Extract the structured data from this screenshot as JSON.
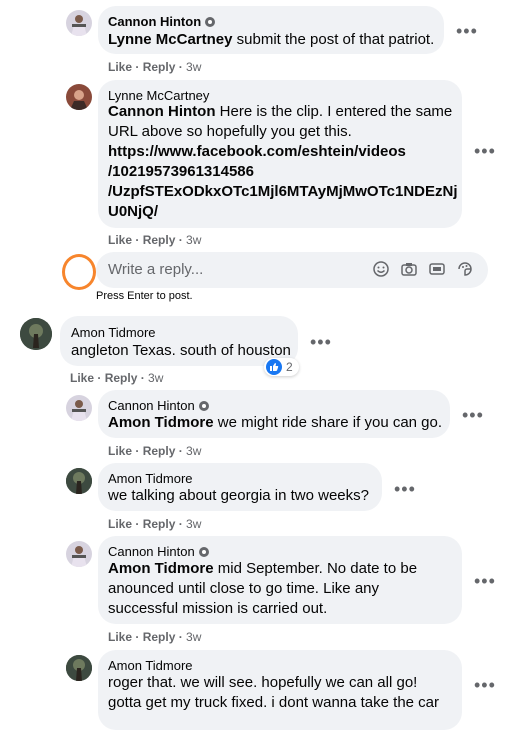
{
  "comments": [
    {
      "name": "Cannon Hinton",
      "mention": "Lynne McCartney",
      "text": " submit the post of that patriot.",
      "like": "Like",
      "reply": "Reply",
      "time": "3w"
    },
    {
      "name": "Lynne McCartney",
      "mention": "Cannon Hinton",
      "text": " Here is the clip. I entered the same URL above so hopefully you get this.",
      "link_line1": "https://www.facebook.com/eshtein/videos",
      "link_line2": "/10219573961314586",
      "link_line3": "/UzpfSTExODkxOTc1Mjl6MTAyMjMwOTc1NDEzNj",
      "link_line4": "U0NjQ/",
      "like": "Like",
      "reply": "Reply",
      "time": "3w"
    },
    {
      "name": "Amon Tidmore",
      "text": "angleton Texas. south of houston",
      "reaction_count": "2",
      "like": "Like",
      "reply": "Reply",
      "time": "3w"
    },
    {
      "name": "Cannon Hinton",
      "mention": "Amon Tidmore",
      "text": " we might ride share if you can go.",
      "like": "Like",
      "reply": "Reply",
      "time": "3w"
    },
    {
      "name": "Amon Tidmore",
      "text": "we talking about georgia in two weeks?",
      "like": "Like",
      "reply": "Reply",
      "time": "3w"
    },
    {
      "name": "Cannon Hinton",
      "mention": "Amon Tidmore",
      "text": " mid September. No date to be anounced until close to go time. Like any successful mission is carried out.",
      "like": "Like",
      "reply": "Reply",
      "time": "3w"
    },
    {
      "name": "Amon Tidmore",
      "text": "roger that. we will see. hopefully we can all go! gotta get my truck fixed. i dont wanna take the car"
    }
  ],
  "reply_box": {
    "placeholder": "Write a reply...",
    "hint": "Press Enter to post."
  },
  "icons": [
    "verified-icon",
    "emoji-icon",
    "camera-icon",
    "gif-icon",
    "sticker-icon",
    "like-reaction-icon",
    "more-options-icon"
  ],
  "colors": {
    "bubble": "#f0f2f5",
    "meta": "#65676b",
    "like_blue": "#1877f2",
    "reply_avatar_ring": "#f7852c"
  }
}
